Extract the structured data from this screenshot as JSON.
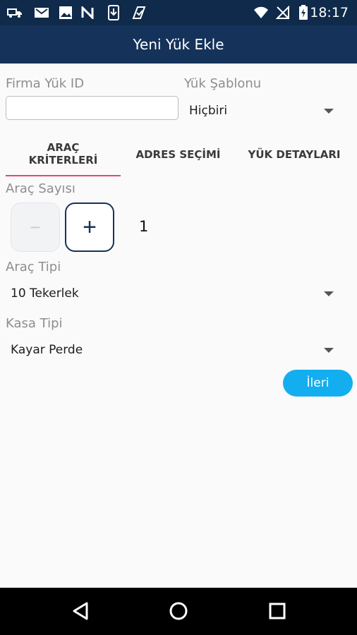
{
  "status_bar": {
    "time": "18:17",
    "left_icons": [
      "truck-icon",
      "gmail-icon",
      "image-icon",
      "n-app-icon",
      "download-icon",
      "check-flag-icon"
    ],
    "right_icons": [
      "wifi-icon",
      "no-signal-icon",
      "battery-icon"
    ]
  },
  "app_bar": {
    "title": "Yeni Yük Ekle"
  },
  "form": {
    "firma_yuk_id_label": "Firma Yük ID",
    "firma_yuk_id_value": "",
    "yuk_sablonu_label": "Yük Şablonu",
    "yuk_sablonu_value": "Hiçbiri"
  },
  "tabs": [
    {
      "label": "ARAÇ\nKRİTERLERİ",
      "active": true
    },
    {
      "label": "ADRES SEÇİMİ",
      "active": false
    },
    {
      "label": "YÜK DETAYLARI",
      "active": false
    }
  ],
  "arac_sayisi": {
    "label": "Araç Sayısı",
    "minus": "−",
    "plus": "+",
    "count": "1"
  },
  "arac_tipi": {
    "label": "Araç Tipi",
    "value": "10 Tekerlek"
  },
  "kasa_tipi": {
    "label": "Kasa Tipi",
    "value": "Kayar Perde"
  },
  "next_button": {
    "label": "İleri"
  },
  "colors": {
    "primary": "#15325a",
    "accent": "#12aef0",
    "tab_indicator": "#e8456e"
  }
}
